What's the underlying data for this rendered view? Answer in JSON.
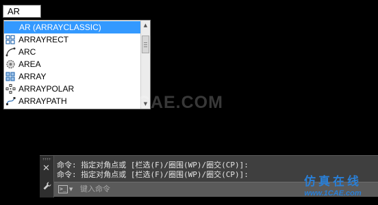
{
  "command_input": {
    "value": "AR"
  },
  "autocomplete": {
    "items": [
      {
        "label": "AR (ARRAYCLASSIC)",
        "icon": "none",
        "selected": true
      },
      {
        "label": "ARRAYRECT",
        "icon": "array-rect-icon",
        "selected": false
      },
      {
        "label": "ARC",
        "icon": "arc-icon",
        "selected": false
      },
      {
        "label": "AREA",
        "icon": "area-icon",
        "selected": false
      },
      {
        "label": "ARRAY",
        "icon": "array-icon",
        "selected": false
      },
      {
        "label": "ARRAYPOLAR",
        "icon": "array-polar-icon",
        "selected": false
      },
      {
        "label": "ARRAYPATH",
        "icon": "array-path-icon",
        "selected": false
      }
    ],
    "selected_color": "#3399ff"
  },
  "watermark": "1CAE.COM",
  "command_panel": {
    "history": [
      "命令: 指定对角点或 [栏选(F)/圈围(WP)/圈交(CP)]:",
      "命令: 指定对角点或 [栏选(F)/圈围(WP)/圈交(CP)]:"
    ],
    "placeholder": "键入命令"
  },
  "brand": {
    "name": "仿真在线",
    "url": "www.1CAE.com",
    "color": "#2a7fd6"
  }
}
